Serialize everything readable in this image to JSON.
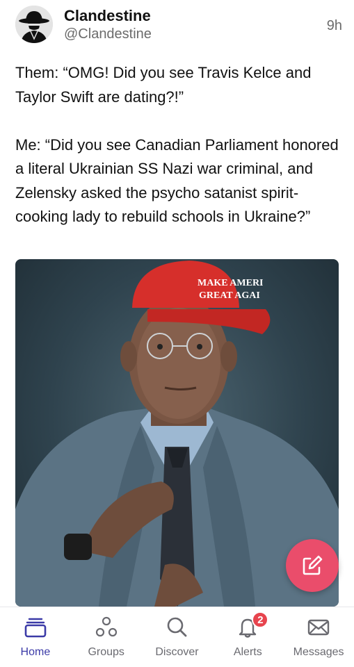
{
  "post": {
    "author_name": "Clandestine",
    "author_handle": "@Clandestine",
    "timestamp": "9h",
    "paragraphs": [
      "Them: “OMG! Did you see Travis Kelce and Taylor Swift are dating?!”",
      "Me: “Did you see Canadian Parliament honored a literal Ukrainian SS Nazi war criminal, and Zelensky asked the psycho satanist spirit-cooking lady to rebuild schools in Ukraine?”"
    ],
    "image": {
      "cap_text_line1": "MAKE AMERI",
      "cap_text_line2": "GREAT AGAI"
    }
  },
  "compose": {
    "icon": "edit-icon"
  },
  "nav": {
    "items": [
      {
        "label": "Home",
        "icon": "home-icon",
        "active": true
      },
      {
        "label": "Groups",
        "icon": "groups-icon",
        "active": false
      },
      {
        "label": "Discover",
        "icon": "search-icon",
        "active": false
      },
      {
        "label": "Alerts",
        "icon": "bell-icon",
        "active": false,
        "badge": "2"
      },
      {
        "label": "Messages",
        "icon": "envelope-icon",
        "active": false
      }
    ]
  },
  "colors": {
    "accent": "#3b3aa7",
    "compose": "#ea4d6b",
    "badge": "#e7444e",
    "muted": "#6b6b6b"
  }
}
